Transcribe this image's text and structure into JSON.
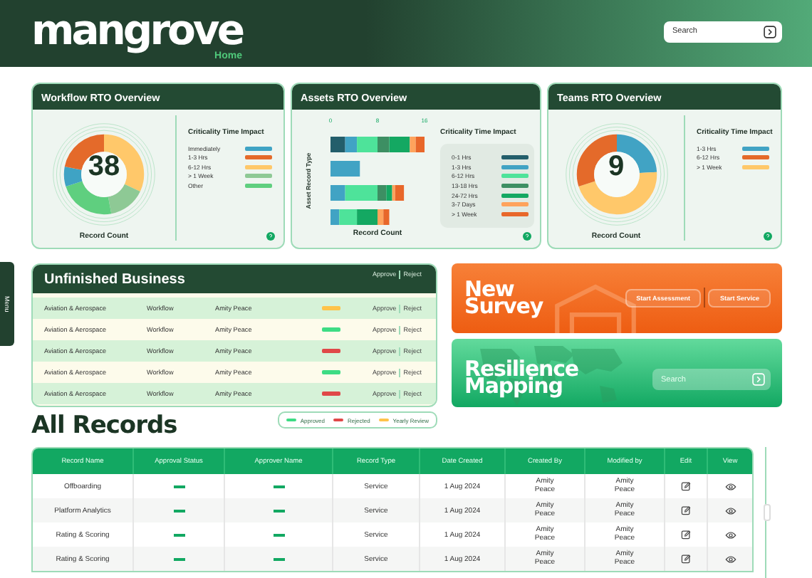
{
  "header": {
    "logo": "mangrove",
    "subtitle": "Home",
    "search": {
      "placeholder": "Search"
    }
  },
  "menu_tab": {
    "label": "Menu"
  },
  "overview_cards": [
    {
      "kind": "donut",
      "title": "Workflow RTO Overview",
      "total": "38",
      "caption": "Record Count",
      "legend_title": "Criticality Time Impact",
      "legend": [
        {
          "label": "Immediately",
          "color": "#3fa3c4"
        },
        {
          "label": "1-3 Hrs",
          "color": "#e46a2a"
        },
        {
          "label": "6-12 Hrs",
          "color": "#ffc86a"
        },
        {
          "label": "> 1 Week",
          "color": "#8ec995"
        },
        {
          "label": "Other",
          "color": "#5fcf7f"
        }
      ]
    },
    {
      "kind": "bar",
      "title": "Assets RTO Overview",
      "legend_title": "Criticality Time Impact",
      "chart_data": {
        "type": "bar",
        "orientation": "horizontal",
        "stacked": true,
        "xlabel": "Record Count",
        "ylabel": "Asset Record Type",
        "xlim": [
          0,
          16
        ],
        "xticks": [
          0,
          8,
          16
        ],
        "series": [
          {
            "name": "0-1 Hrs",
            "color": "#235e6b",
            "values": [
              2.5,
              0,
              0,
              0
            ]
          },
          {
            "name": "1-3 Hrs",
            "color": "#41a3c4",
            "values": [
              2,
              5,
              2.5,
              1.5
            ]
          },
          {
            "name": "6-12 Hrs",
            "color": "#4ee39a",
            "values": [
              3.5,
              0,
              5.5,
              3
            ]
          },
          {
            "name": "13-18 Hrs",
            "color": "#3d8f63",
            "values": [
              2,
              0,
              1.5,
              0
            ]
          },
          {
            "name": "24-72 Hrs",
            "color": "#14a862",
            "values": [
              3.5,
              0,
              1,
              3.5
            ]
          },
          {
            "name": "3-7 Days",
            "color": "#ffa35c",
            "values": [
              1,
              0,
              0.5,
              1
            ]
          },
          {
            "name": "> 1 Week",
            "color": "#e8672a",
            "values": [
              1.5,
              0,
              1.5,
              1
            ]
          }
        ]
      }
    },
    {
      "kind": "donut",
      "title": "Teams RTO Overview",
      "total": "9",
      "caption": "Record Count",
      "legend_title": "Criticality Time Impact",
      "legend": [
        {
          "label": "1-3 Hrs",
          "color": "#41a3c4"
        },
        {
          "label": "6-12 Hrs",
          "color": "#e46a2a"
        },
        {
          "label": "> 1 Week",
          "color": "#ffc86a"
        }
      ]
    }
  ],
  "unfinished_business": {
    "title": "Unfinished Business",
    "header_actions": [
      "Approve",
      "Reject"
    ],
    "rows": [
      {
        "organization": "Aviation & Aerospace",
        "record_type": "Workflow",
        "owner": "Amity Peace",
        "status": {
          "color": "#ffc34a"
        },
        "actions": [
          "Approve",
          "Reject"
        ]
      },
      {
        "organization": "Aviation & Aerospace",
        "record_type": "Workflow",
        "owner": "Amity Peace",
        "status": {
          "color": "#3ddc84"
        },
        "actions": [
          "Approve",
          "Reject"
        ]
      },
      {
        "organization": "Aviation & Aerospace",
        "record_type": "Workflow",
        "owner": "Amity Peace",
        "status": {
          "color": "#e04848"
        },
        "actions": [
          "Approve",
          "Reject"
        ]
      },
      {
        "organization": "Aviation & Aerospace",
        "record_type": "Workflow",
        "owner": "Amity Peace",
        "status": {
          "color": "#3ddc84"
        },
        "actions": [
          "Approve",
          "Reject"
        ]
      },
      {
        "organization": "Aviation & Aerospace",
        "record_type": "Workflow",
        "owner": "Amity Peace",
        "status": {
          "color": "#e04848"
        },
        "actions": [
          "Approve",
          "Reject"
        ]
      }
    ]
  },
  "status_legend": [
    {
      "label": "Approved",
      "color": "#3ddc84"
    },
    {
      "label": "Rejected",
      "color": "#e04848"
    },
    {
      "label": "Yearly Review",
      "color": "#ffc34a"
    }
  ],
  "new_survey": {
    "title": "New Survey",
    "buttons": [
      "Start Assessment",
      "Start Service"
    ]
  },
  "resilience_mapping": {
    "title": "Resilience Mapping",
    "search": {
      "placeholder": "Search"
    }
  },
  "all_records": {
    "title": "All Records",
    "columns": [
      "Record Name",
      "Approval Status",
      "Approver Name",
      "Record Type",
      "Date Created",
      "Created By",
      "Modified by",
      "Edit",
      "View"
    ],
    "rows": [
      {
        "name": "Offboarding",
        "type": "Service",
        "date": "1 Aug 2024",
        "created_by": "Amity Peace",
        "modified_by": "Amity Peace"
      },
      {
        "name": "Platform Analytics",
        "type": "Service",
        "date": "1 Aug 2024",
        "created_by": "Amity Peace",
        "modified_by": "Amity Peace"
      },
      {
        "name": "Rating & Scoring",
        "type": "Service",
        "date": "1 Aug 2024",
        "created_by": "Amity Peace",
        "modified_by": "Amity Peace"
      },
      {
        "name": "Rating & Scoring",
        "type": "Service",
        "date": "1 Aug 2024",
        "created_by": "Amity Peace",
        "modified_by": "Amity Peace"
      }
    ]
  }
}
